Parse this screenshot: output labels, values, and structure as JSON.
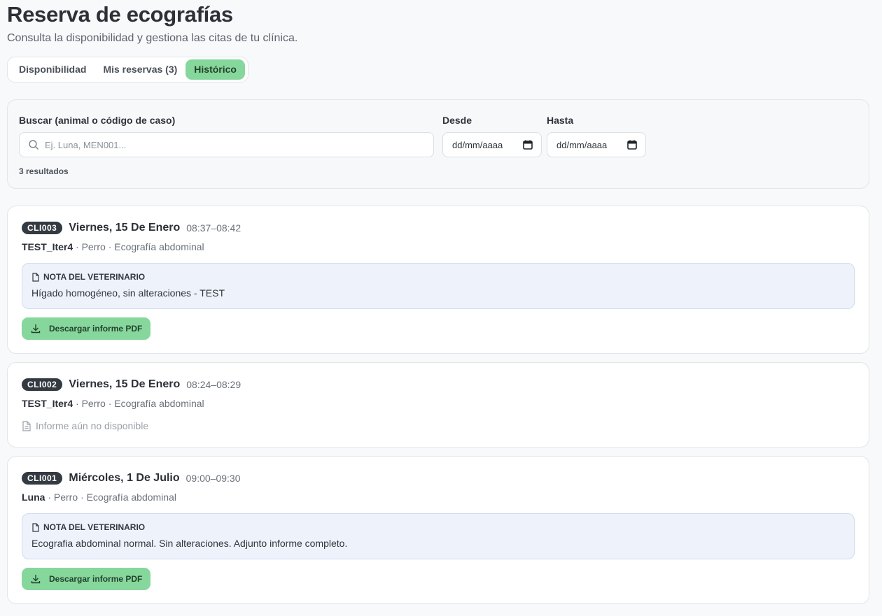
{
  "header": {
    "title": "Reserva de ecografías",
    "subtitle": "Consulta la disponibilidad y gestiona las citas de tu clínica."
  },
  "tabs": [
    {
      "label": "Disponibilidad",
      "active": false
    },
    {
      "label": "Mis reservas (3)",
      "active": false
    },
    {
      "label": "Histórico",
      "active": true
    }
  ],
  "filters": {
    "search_label": "Buscar (animal o código de caso)",
    "search_placeholder": "Ej. Luna, MEN001...",
    "search_value": "",
    "from_label": "Desde",
    "from_value": "dd/mm/aaaa",
    "to_label": "Hasta",
    "to_value": "dd/mm/aaaa",
    "results_text": "3 resultados"
  },
  "records": [
    {
      "code": "CLI003",
      "date": "Viernes, 15 De Enero",
      "time": "08:37–08:42",
      "animal": "TEST_Iter4",
      "details": " · Perro · Ecografía abdominal",
      "note_title": "NOTA DEL VETERINARIO",
      "note_text": "Hígado homogéneo, sin alteraciones - TEST",
      "pdf_label": "Descargar informe PDF"
    },
    {
      "code": "CLI002",
      "date": "Viernes, 15 De Enero",
      "time": "08:24–08:29",
      "animal": "TEST_Iter4",
      "details": " · Perro · Ecografía abdominal",
      "pending_text": "Informe aún no disponible"
    },
    {
      "code": "CLI001",
      "date": "Miércoles, 1 De Julio",
      "time": "09:00–09:30",
      "animal": "Luna",
      "details": " · Perro · Ecografía abdominal",
      "note_title": "NOTA DEL VETERINARIO",
      "note_text": "Ecografia abdominal normal. Sin alteraciones. Adjunto informe completo.",
      "pdf_label": "Descargar informe PDF"
    }
  ],
  "icons": {
    "search": "search-icon",
    "calendar": "calendar-icon",
    "note": "document-icon",
    "download": "download-icon",
    "pending": "document-lines-icon"
  },
  "colors": {
    "accent": "#86d79b",
    "badge": "#343a41",
    "note_bg": "#eef3fb"
  }
}
